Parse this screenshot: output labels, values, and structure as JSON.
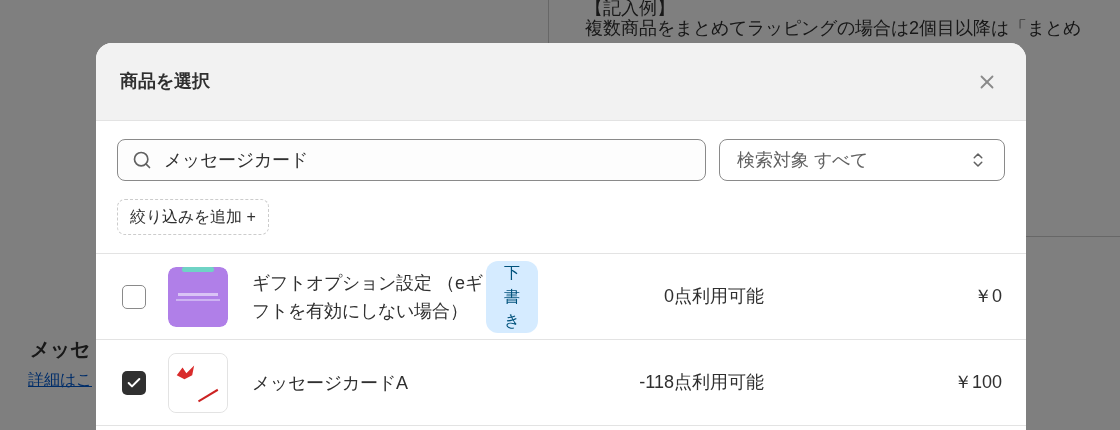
{
  "background": {
    "example_heading": "【記入例】",
    "example_text": "複数商品をまとめてラッピングの場合は2個目以降は「まとめ",
    "section_title": "メッセ",
    "details_link": "詳細はこ"
  },
  "dialog": {
    "title": "商品を選択",
    "search": {
      "value": "メッセージカード"
    },
    "scope_select": {
      "value": "検索対象 すべて"
    },
    "add_filter": "絞り込みを追加 +",
    "products": [
      {
        "name": "ギフトオプション設定 （eギフトを有効にしない場合）",
        "badge": "下書き",
        "availability": "0点利用可能",
        "price": "￥0",
        "checked": false
      },
      {
        "name": "メッセージカードA",
        "availability": "-118点利用可能",
        "price": "￥100",
        "checked": true
      }
    ]
  }
}
